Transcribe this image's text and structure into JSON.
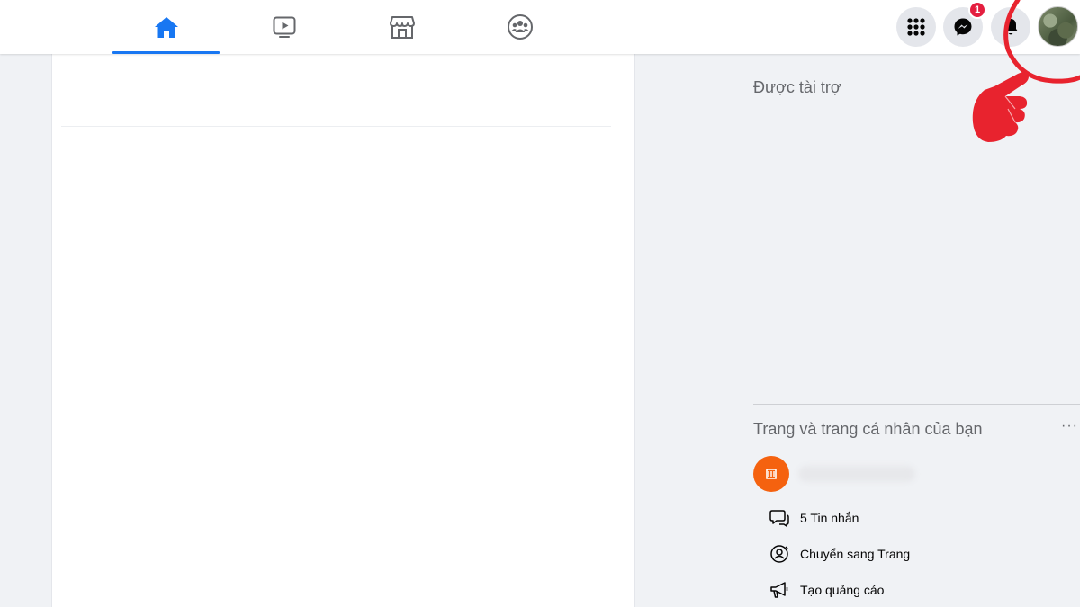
{
  "nav": {
    "tabs": [
      {
        "id": "home",
        "icon": "home-icon",
        "active": true
      },
      {
        "id": "watch",
        "icon": "video-icon",
        "active": false
      },
      {
        "id": "marketplace",
        "icon": "marketplace-icon",
        "active": false
      },
      {
        "id": "groups",
        "icon": "groups-icon",
        "active": false
      }
    ],
    "accent_color": "#1877f2"
  },
  "header_actions": {
    "menu_icon": "grid-menu-icon",
    "messenger_icon": "messenger-icon",
    "messenger_badge": "1",
    "notifications_icon": "bell-icon",
    "account_icon": "profile-avatar"
  },
  "right_column": {
    "sponsored_title": "Được tài trợ",
    "pages_title": "Trang và trang cá nhân của bạn",
    "more_label": "···",
    "page_icon": "page-logo-icon",
    "actions": [
      {
        "label": "5 Tin nhắn",
        "icon": "message-icon"
      },
      {
        "label": "Chuyển sang Trang",
        "icon": "switch-profile-icon"
      },
      {
        "label": "Tạo quảng cáo",
        "icon": "megaphone-icon"
      }
    ]
  },
  "annotation": {
    "highlight_color": "#e8232e",
    "pointer_icon": "pointing-hand-icon"
  }
}
